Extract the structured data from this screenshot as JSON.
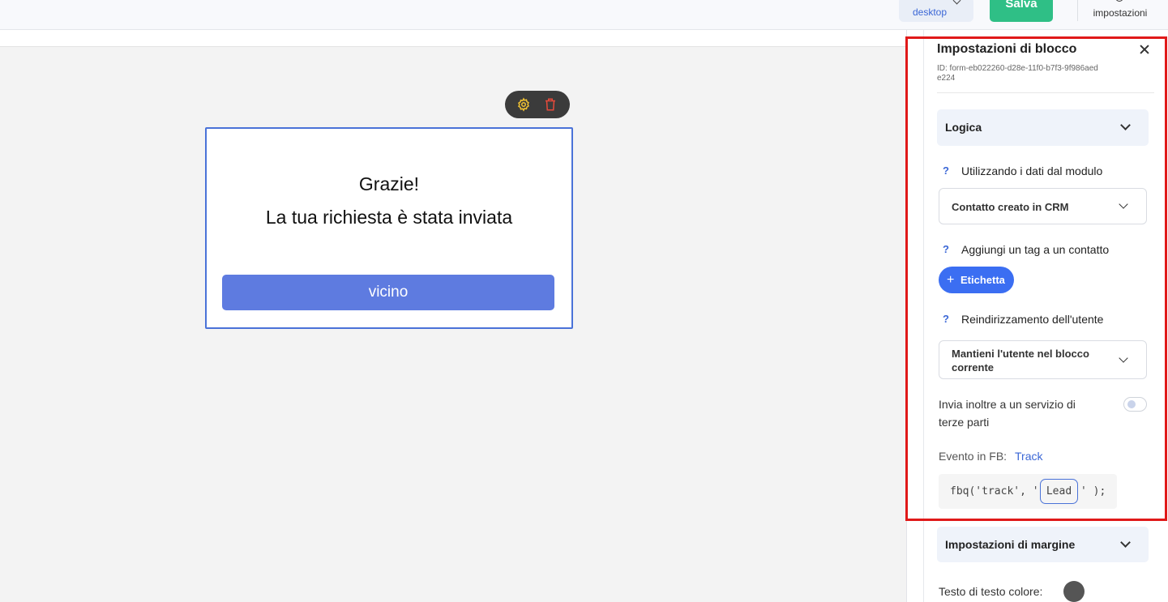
{
  "topbar": {
    "device_label": "desktop",
    "save_label": "Salva",
    "settings_label": "impostazioni"
  },
  "canvas": {
    "thanks_line1": "Grazie!",
    "thanks_line2": "La tua richiesta è stata inviata",
    "button_label": "vicino"
  },
  "panel": {
    "title": "Impostazioni di blocco",
    "block_id": "ID: form-eb022260-d28e-11f0-b7f3-9f986aede224",
    "logic_section": "Logica",
    "data_help": "?",
    "data_label": "Utilizzando i dati dal modulo",
    "data_select": "Contatto creato in CRM",
    "tag_help": "?",
    "tag_label": "Aggiungi un tag a un contatto",
    "tag_button_plus": "+",
    "tag_button": "Etichetta",
    "redirect_help": "?",
    "redirect_label": "Reindirizzamento dell'utente",
    "redirect_select": "Mantieni l'utente nel blocco corrente",
    "forward_label": "Invia inoltre a un servizio di terze parti",
    "forward_enabled": false,
    "fb_label": "Evento in FB:",
    "fb_link": "Track",
    "code_prefix": "fbq('track', '",
    "code_value": "Lead",
    "code_suffix": "' );",
    "margin_section": "Impostazioni di margine",
    "text_color_label": "Testo di testo colore:",
    "text_color": "#555555"
  }
}
